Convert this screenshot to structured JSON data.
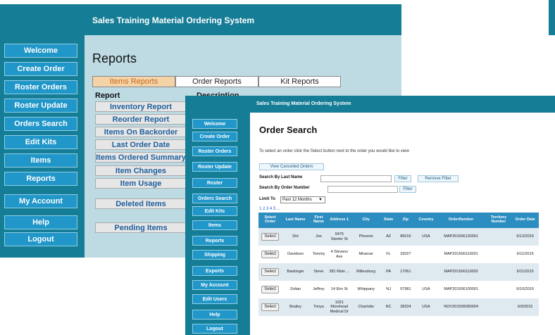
{
  "app_title": "Sales Training Material Ordering System",
  "back_window": {
    "nav": [
      "Welcome",
      "Create Order",
      "Roster Orders",
      "Roster Update",
      "Orders Search",
      "Edit Kits",
      "Items",
      "Reports",
      "My Account",
      "Help",
      "Logout"
    ],
    "page_title": "Reports",
    "tabs": [
      "Items Reports",
      "Order Reports",
      "Kit Reports"
    ],
    "col_report": "Report",
    "col_description": "Description",
    "reports": [
      "Inventory Report",
      "Reorder Report",
      "Items On Backorder",
      "Last Order Date",
      "Items Ordered Summary",
      "Item Changes",
      "Item Usage",
      "Deleted Items",
      "Pending Items"
    ]
  },
  "front_window": {
    "nav": [
      "Welcome",
      "Create Order",
      "Roster Orders",
      "Roster Update",
      "Roster",
      "Orders Search",
      "Edit Kits",
      "Items",
      "Reports",
      "Shipping",
      "Exports",
      "My Account",
      "Edit Users",
      "Help",
      "Logout"
    ],
    "page_title": "Order Search",
    "instructions": "To select an order click the Select button next to the order you would like to view",
    "view_cancelled": "View Cancelled Orders",
    "search_last_name_label": "Search By Last Name",
    "search_order_label": "Search By Order Number",
    "filter_label": "Filter",
    "remove_filter_label": "Remove Filter",
    "limit_label": "Limit To",
    "limit_value": "Past 12 Months",
    "pages": "1 2 3 4 5 ...",
    "columns": [
      "Select Order",
      "Last Name",
      "First Name",
      "Address 1",
      "City",
      "State",
      "Zip",
      "Country",
      "OrderNumber",
      "Territory Number",
      "Order Date"
    ],
    "select_label": "Select",
    "rows": [
      {
        "last": "Dirt",
        "first": "Joe",
        "address": "9475 Steeler St",
        "city": "Phoenix",
        "state": "AZ",
        "zip": "85016",
        "country": "USA",
        "order": "MAP201506120001",
        "territory": "",
        "date": "6/12/2015"
      },
      {
        "last": "Davidson",
        "first": "Tommy",
        "address": "4 Stevens Ave",
        "city": "Miramar",
        "state": "FL",
        "zip": "33027",
        "country": "",
        "order": "MAP201506110001",
        "territory": "",
        "date": "6/11/2015"
      },
      {
        "last": "Baskinger",
        "first": "Steve",
        "address": "381 Main ...",
        "city": "Millersburg",
        "state": "PA",
        "zip": "17061",
        "country": "",
        "order": "MAP201506110002",
        "territory": "",
        "date": "6/11/2015"
      },
      {
        "last": "Zoltan",
        "first": "Jeffrey",
        "address": "14 Elm St",
        "city": "Whippany",
        "state": "NJ",
        "zip": "07981",
        "country": "USA",
        "order": "MAP201506100001",
        "territory": "",
        "date": "6/10/2015"
      },
      {
        "last": "Brailey",
        "first": "Tonya",
        "address": "1021 Morehead Medical Dr",
        "city": "Charlotte",
        "state": "NC",
        "zip": "28204",
        "country": "USA",
        "order": "NOV201506090004",
        "territory": "",
        "date": "6/9/2015"
      }
    ]
  },
  "colors": {
    "nav_bg": "#167d96",
    "button": "#2196c8",
    "panel": "#bedbe4",
    "header": "#2c8ec0",
    "active_tab": "#f4d3a8"
  }
}
